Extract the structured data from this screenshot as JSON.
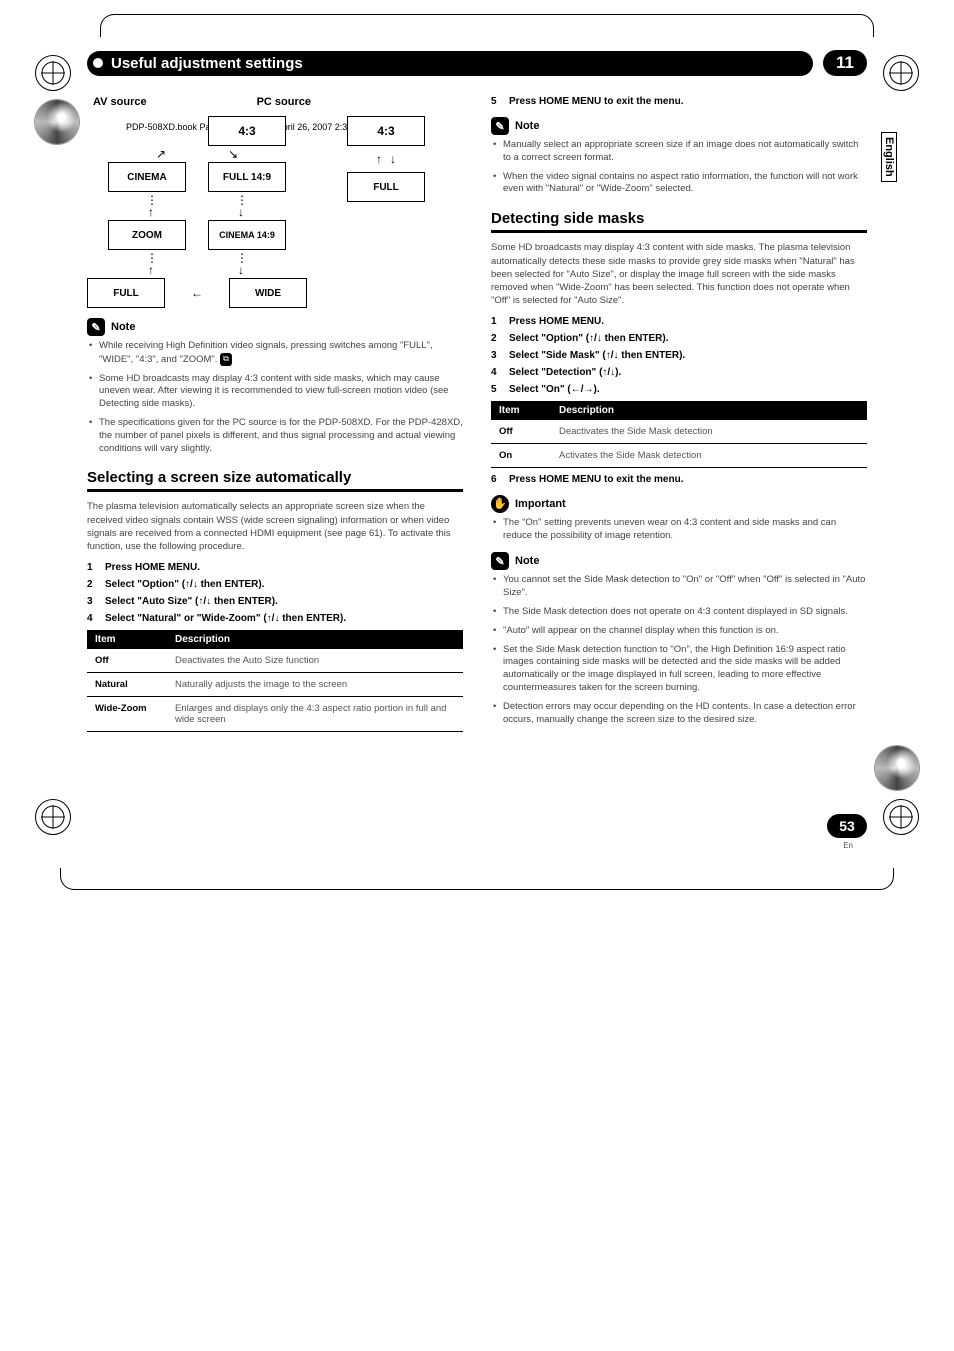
{
  "bookline": "PDP-508XD.book  Page 53  Thursday, April 26, 2007  2:34 PM",
  "chapter": {
    "title": "Useful adjustment settings",
    "number": "11"
  },
  "sideTab": "English",
  "sources": {
    "av": "AV source",
    "pc": "PC source"
  },
  "nodes": {
    "n43": "4:3",
    "cinema": "CINEMA",
    "full149": "FULL 14:9",
    "zoom": "ZOOM",
    "cinema149": "CINEMA 14:9",
    "full": "FULL",
    "wide": "WIDE",
    "pc43": "4:3",
    "pcfull": "FULL"
  },
  "noteLabel": "Note",
  "importantLabel": "Important",
  "leftNotes": [
    "While receiving High Definition video signals, pressing  switches among \"FULL\", \"WIDE\", \"4:3\", and \"ZOOM\".",
    "Some HD broadcasts may display 4:3 content with side masks, which may cause uneven wear. After viewing it is recommended to view full-screen motion video (see Detecting side masks).",
    "The specifications given for the PC source is for the PDP-508XD. For the PDP-428XD, the number of panel pixels is different, and thus signal processing and actual viewing conditions will vary slightly."
  ],
  "section1": {
    "title": "Selecting a screen size automatically",
    "desc": "The plasma television automatically selects an appropriate screen size when the received video signals contain WSS (wide screen signaling) information or when video signals are received from a connected HDMI equipment (see page 61). To activate this function, use the following procedure.",
    "steps": [
      "Press HOME MENU.",
      "Select \"Option\" (↑/↓ then ENTER).",
      "Select \"Auto Size\" (↑/↓ then ENTER).",
      "Select \"Natural\" or \"Wide-Zoom\" (↑/↓ then ENTER)."
    ],
    "table": {
      "headers": [
        "Item",
        "Description"
      ],
      "rows": [
        [
          "Off",
          "Deactivates the Auto Size function"
        ],
        [
          "Natural",
          "Naturally adjusts the image to the screen"
        ],
        [
          "Wide-Zoom",
          "Enlarges and displays only the 4:3 aspect ratio portion in full and wide screen"
        ]
      ]
    }
  },
  "rightTop": {
    "step5": "Press HOME MENU to exit the menu.",
    "notes": [
      "Manually select an appropriate screen size if an image does not automatically switch to a correct screen format.",
      "When the video signal contains no aspect ratio information, the function will not work even with \"Natural\" or \"Wide-Zoom\" selected."
    ]
  },
  "section2": {
    "title": "Detecting side masks",
    "desc": "Some HD broadcasts may display 4:3 content with side masks. The plasma television automatically detects these side masks to provide grey side masks when \"Natural\" has been selected for \"Auto Size\", or display the image full screen with the side masks removed when \"Wide-Zoom\" has been selected. This function does not operate when \"Off\" is selected for \"Auto Size\".",
    "steps": [
      "Press HOME MENU.",
      "Select \"Option\" (↑/↓ then ENTER).",
      "Select \"Side Mask\" (↑/↓ then ENTER).",
      "Select \"Detection\" (↑/↓).",
      "Select \"On\" (←/→)."
    ],
    "table": {
      "headers": [
        "Item",
        "Description"
      ],
      "rows": [
        [
          "Off",
          "Deactivates the Side Mask detection"
        ],
        [
          "On",
          "Activates the Side Mask detection"
        ]
      ]
    },
    "step6": "Press HOME MENU to exit the menu.",
    "important": [
      "The \"On\" setting prevents uneven wear on 4:3 content and side masks and can reduce the possibility of image retention."
    ],
    "notes": [
      "You cannot set the Side Mask detection to \"On\" or \"Off\" when \"Off\" is selected in \"Auto Size\".",
      "The Side Mask detection does not operate on 4:3 content displayed in SD signals.",
      "\"Auto\" will appear on the channel display when this function is on.",
      "Set the Side Mask detection function to \"On\", the High Definition 16:9 aspect ratio images containing side masks will be detected and the side masks will be added automatically or the image displayed in full screen, leading to more effective countermeasures taken for the screen burning.",
      "Detection errors may occur depending on the HD contents. In case a detection error occurs, manually change the screen size to the desired size."
    ]
  },
  "footer": {
    "page": "53",
    "lang": "En"
  }
}
